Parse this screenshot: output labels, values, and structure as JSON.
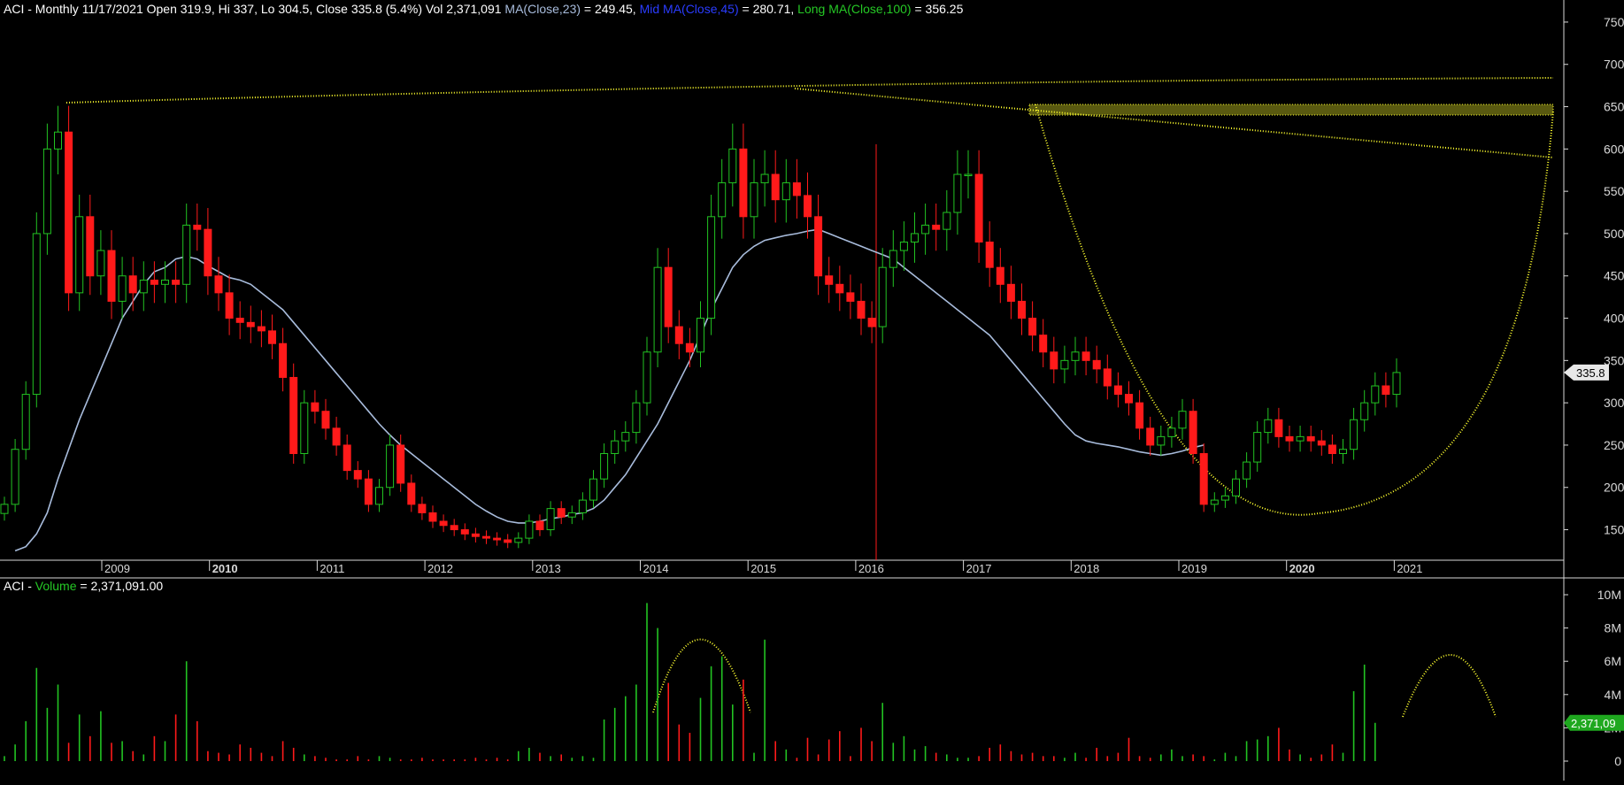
{
  "header": {
    "symbol": "ACI",
    "period": " - Monthly 11/17/2021 ",
    "open_label": "Open ",
    "open": "319.9",
    "hi_label": ", Hi ",
    "hi": "337",
    "lo_label": ", Lo ",
    "lo": "304.5",
    "close_label": ", Close ",
    "close": "335.8",
    "change": " (5.4%)",
    "vol_label": " Vol ",
    "vol": "2,371,091",
    "ma_label": " MA(Close,23)",
    "ma_value": " = 249.45,",
    "mid_label": " Mid MA(Close,45)",
    "mid_value": " = 280.71,",
    "long_label": " Long MA(Close,100)",
    "long_value": " = 356.25"
  },
  "volume_header": {
    "symbol": "ACI",
    "sep": " - ",
    "label": "Volume",
    "value": " = 2,371,091.00"
  },
  "colors": {
    "background": "#000000",
    "up": "#22c322",
    "down": "#ff1a1a",
    "ma": "#a8bcdc",
    "mid_ma": "#2a3cff",
    "long_ma": "#25c825",
    "annotation": "#ffff2e",
    "axis": "#d8d8d8"
  },
  "chart_data": [
    {
      "type": "candlestick",
      "name": "ACI monthly price",
      "x_unit": "months since Aug 2008",
      "ylim": [
        115,
        770
      ],
      "y_ticks": [
        150,
        200,
        250,
        300,
        350,
        400,
        450,
        500,
        550,
        600,
        650,
        700,
        750
      ],
      "x_ticks": [
        "2009",
        "2010",
        "2011",
        "2012",
        "2013",
        "2014",
        "2015",
        "2016",
        "2017",
        "2018",
        "2019",
        "2020",
        "2021"
      ],
      "x_ticks_bold": [
        "2010",
        "2020"
      ],
      "last_price_tag": "335.8",
      "closes": [
        180,
        245,
        310,
        500,
        600,
        620,
        430,
        520,
        450,
        480,
        420,
        450,
        430,
        445,
        440,
        445,
        440,
        510,
        505,
        450,
        430,
        400,
        395,
        390,
        385,
        370,
        330,
        240,
        300,
        290,
        270,
        250,
        220,
        210,
        180,
        200,
        250,
        205,
        180,
        170,
        160,
        155,
        150,
        145,
        142,
        140,
        138,
        135,
        140,
        160,
        150,
        175,
        165,
        170,
        185,
        210,
        240,
        255,
        265,
        300,
        360,
        460,
        390,
        370,
        360,
        400,
        520,
        560,
        600,
        520,
        560,
        570,
        540,
        560,
        545,
        520,
        450,
        440,
        430,
        420,
        400,
        390,
        460,
        480,
        490,
        500,
        510,
        505,
        525,
        570,
        570,
        490,
        460,
        440,
        420,
        400,
        380,
        360,
        340,
        350,
        360,
        350,
        340,
        320,
        310,
        300,
        270,
        250,
        260,
        270,
        290,
        240,
        180,
        185,
        190,
        210,
        230,
        265,
        280,
        260,
        255,
        260,
        255,
        250,
        240,
        245,
        280,
        300,
        320,
        310,
        335.8
      ],
      "ma_23": [
        125,
        130,
        145,
        170,
        210,
        245,
        280,
        310,
        340,
        370,
        400,
        420,
        440,
        455,
        460,
        470,
        473,
        470,
        462,
        455,
        448,
        445,
        440,
        430,
        420,
        410,
        395,
        380,
        365,
        350,
        335,
        320,
        305,
        290,
        275,
        262,
        250,
        240,
        230,
        220,
        210,
        200,
        190,
        180,
        172,
        165,
        160,
        158,
        158,
        160,
        163,
        165,
        168,
        170,
        175,
        185,
        200,
        215,
        235,
        255,
        275,
        300,
        325,
        350,
        380,
        410,
        435,
        460,
        475,
        485,
        492,
        495,
        498,
        500,
        503,
        505,
        500,
        495,
        490,
        485,
        480,
        475,
        470,
        460,
        450,
        440,
        430,
        420,
        410,
        400,
        390,
        380,
        365,
        350,
        335,
        320,
        305,
        290,
        275,
        262,
        255,
        252,
        250,
        248,
        245,
        242,
        240,
        238,
        240,
        243,
        247,
        250
      ]
    },
    {
      "type": "bar",
      "name": "Volume",
      "ylim": [
        0,
        11000000
      ],
      "y_ticks": [
        {
          "v": 0,
          "label": "0"
        },
        {
          "v": 2000000,
          "label": "2M"
        },
        {
          "v": 4000000,
          "label": "4M"
        },
        {
          "v": 6000000,
          "label": "6M"
        },
        {
          "v": 8000000,
          "label": "8M"
        },
        {
          "v": 10000000,
          "label": "10M"
        }
      ],
      "last_value_tag": "2,371,09",
      "values_millions": [
        0.3,
        1.0,
        2.4,
        5.6,
        3.2,
        4.6,
        1.1,
        2.8,
        1.5,
        3.0,
        1.1,
        1.2,
        0.6,
        0.4,
        1.5,
        1.2,
        2.8,
        6.0,
        2.4,
        0.6,
        0.5,
        0.4,
        1.0,
        0.8,
        0.5,
        0.3,
        1.2,
        0.8,
        0.4,
        0.3,
        0.2,
        0.1,
        0.1,
        0.3,
        0.1,
        0.3,
        0.2,
        0.1,
        0.1,
        0.2,
        0.1,
        0.1,
        0.1,
        0.1,
        0.2,
        0.1,
        0.2,
        0.1,
        0.6,
        0.8,
        0.5,
        0.3,
        0.4,
        0.2,
        0.3,
        0.2,
        2.5,
        3.2,
        3.9,
        4.6,
        9.5,
        8.0,
        4.7,
        2.2,
        1.7,
        3.8,
        5.7,
        6.3,
        3.4,
        4.9,
        0.5,
        7.3,
        1.2,
        0.7,
        0.2,
        1.4,
        0.4,
        1.3,
        1.8,
        0.3,
        2.0,
        1.2,
        3.5,
        1.1,
        1.5,
        0.7,
        0.9,
        0.5,
        0.4,
        0.2,
        0.2,
        0.3,
        0.8,
        1.0,
        0.6,
        0.4,
        0.5,
        0.3,
        0.3,
        0.2,
        0.5,
        0.2,
        0.8,
        0.3,
        0.5,
        1.4,
        0.3,
        0.2,
        0.4,
        0.7,
        0.3,
        0.4,
        0.3,
        0.1,
        0.5,
        0.3,
        1.2,
        1.3,
        1.5,
        2.0,
        0.7,
        0.4,
        0.2,
        0.4,
        1.0,
        0.5,
        4.2,
        5.8,
        2.3
      ]
    }
  ]
}
